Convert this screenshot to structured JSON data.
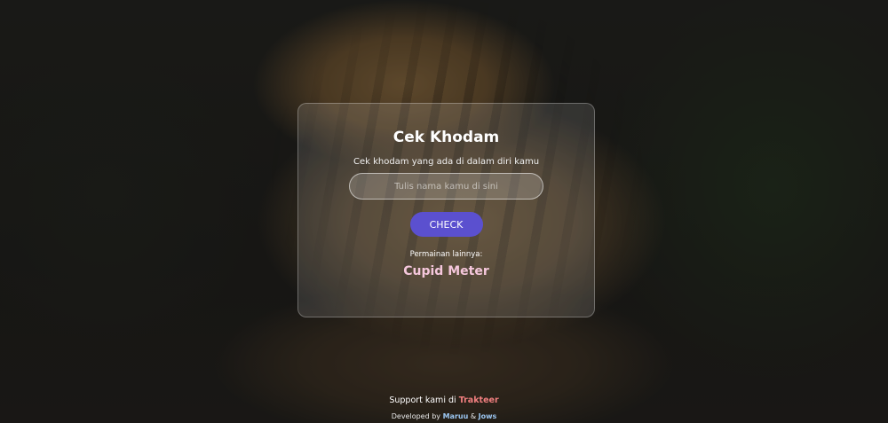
{
  "card": {
    "title": "Cek Khodam",
    "subtitle": "Cek khodam yang ada di dalam diri kamu",
    "input_placeholder": "Tulis nama kamu di sini",
    "input_value": "",
    "check_label": "CHECK",
    "other_games_label": "Permainan lainnya:",
    "other_game_link": "Cupid Meter"
  },
  "footer": {
    "support_prefix": "Support kami di",
    "support_link": "Trakteer",
    "developed_prefix": "Developed by",
    "dev1": "Maruu",
    "separator": "&",
    "dev2": "Jows"
  },
  "colors": {
    "button": "#5b50cf",
    "game_link": "#f5c7dc",
    "support_link": "#f07f7f",
    "dev_link": "#9cc7f2"
  }
}
